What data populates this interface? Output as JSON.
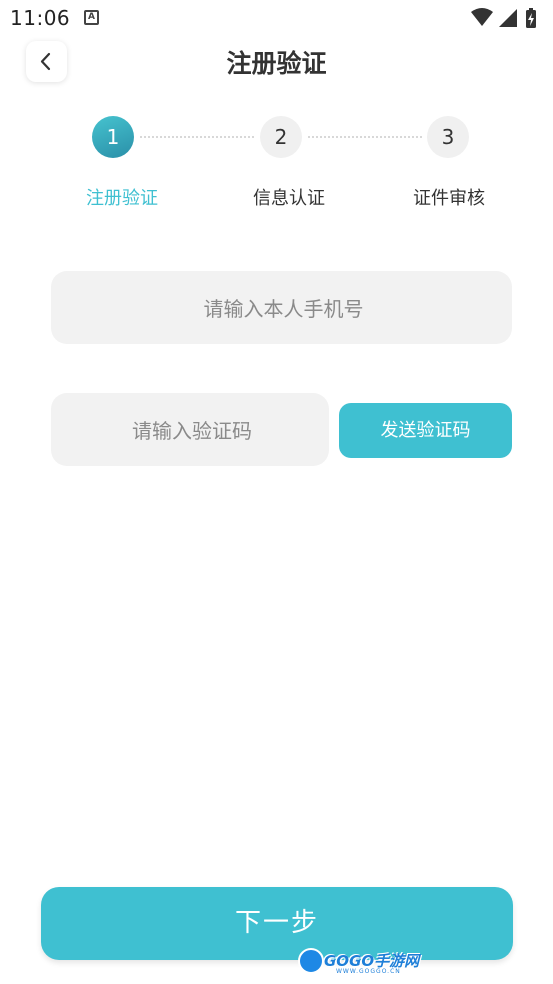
{
  "status_bar": {
    "time": "11:06",
    "notification_icon": "a-icon",
    "right_icons": [
      "wifi-icon",
      "signal-icon",
      "battery-charging-icon"
    ]
  },
  "header": {
    "title": "注册验证",
    "back_icon": "chevron-left-icon"
  },
  "stepper": {
    "steps": [
      {
        "number": "1",
        "label": "注册验证",
        "active": true
      },
      {
        "number": "2",
        "label": "信息认证",
        "active": false
      },
      {
        "number": "3",
        "label": "证件审核",
        "active": false
      }
    ]
  },
  "form": {
    "phone": {
      "value": "",
      "placeholder": "请输入本人手机号"
    },
    "code": {
      "value": "",
      "placeholder": "请输入验证码"
    },
    "send_code_label": "发送验证码"
  },
  "footer": {
    "next_label": "下一步"
  },
  "watermark": {
    "text": "GOGO手游网",
    "sub": "WWW.GOGGO.CN"
  },
  "colors": {
    "accent": "#3fc0d1",
    "active_step_gradient_end": "#2a8fa8",
    "field_background": "#f2f2f2",
    "title_text": "#333333"
  }
}
